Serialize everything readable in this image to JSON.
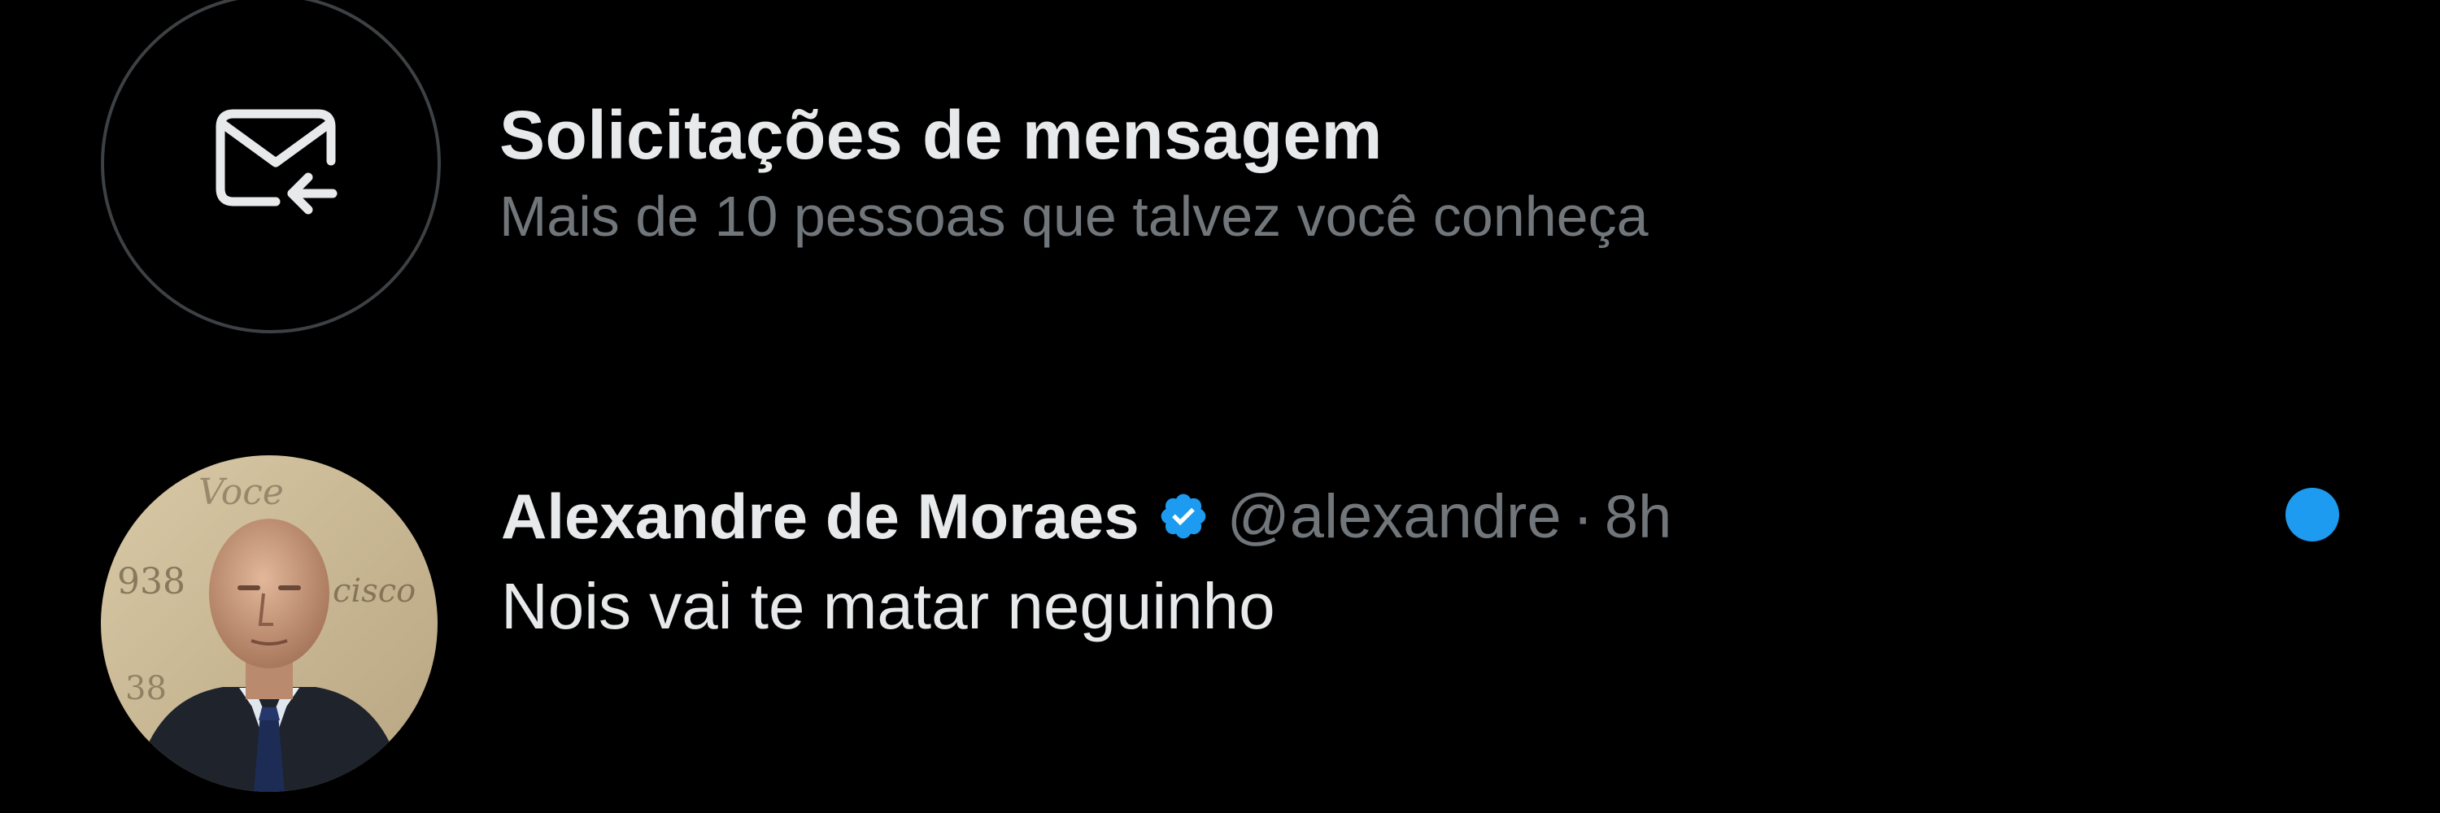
{
  "message_requests": {
    "icon": "envelope-incoming-icon",
    "title": "Solicitações de mensagem",
    "subtitle": "Mais de 10 pessoas que talvez você conheça"
  },
  "conversation": {
    "name": "Alexandre de Moraes",
    "verified": true,
    "handle": "@alexandre",
    "separator": "·",
    "time": "8h",
    "message": "Nois vai te matar neguinho",
    "unread": true
  },
  "colors": {
    "background": "#000000",
    "primary_text": "#e7e9ea",
    "secondary_text": "#71767b",
    "accent": "#1d9bf0"
  }
}
